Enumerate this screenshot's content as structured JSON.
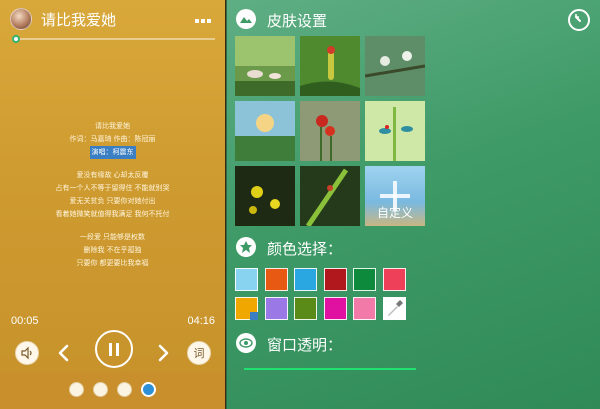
{
  "player": {
    "song_title": "请比我爱她",
    "progress": 0.01,
    "current_time": "00:05",
    "total_time": "04:16",
    "lyric_button": "词",
    "lyrics": [
      {
        "text": "请比我爱她"
      },
      {
        "text": "作词：马嘉琦 作曲：陈冠丽"
      },
      {
        "text": "演唱：柯震东",
        "highlight": true
      },
      {
        "text": ""
      },
      {
        "text": "爱没有缘故 心却太反覆"
      },
      {
        "text": "占有一个人不等于留得住 不能就别哭"
      },
      {
        "text": "爱无关贫负 只要你对她付出"
      },
      {
        "text": "看着她微笑就值得我满足 我何不托付"
      },
      {
        "text": ""
      },
      {
        "text": "一段爱 只能够是权数"
      },
      {
        "text": "删除我 不在乎孤独"
      },
      {
        "text": "只要你 都更要比我幸福"
      }
    ],
    "page_dots": 4,
    "active_dot": 3
  },
  "skin": {
    "title": "皮肤设置",
    "custom_label": "自定义",
    "color_title": "颜色选择：",
    "colors": [
      "#88d4f0",
      "#e85a14",
      "#2aa6e0",
      "#b0181e",
      "#0e8a3c",
      "#ee4058",
      "#f0a800",
      "#9a78e6",
      "#5a8a18",
      "#e010a0",
      "#f27aa8"
    ],
    "selected_color": 6,
    "opacity_title": "窗口透明："
  }
}
